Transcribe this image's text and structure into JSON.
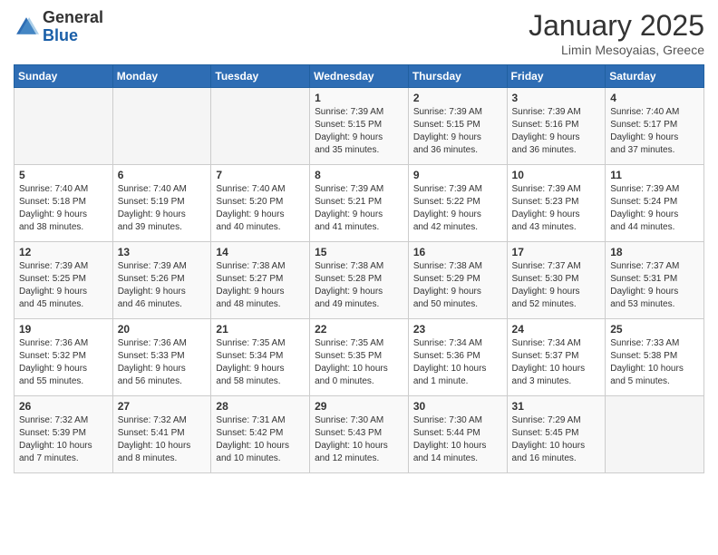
{
  "header": {
    "logo_general": "General",
    "logo_blue": "Blue",
    "month_title": "January 2025",
    "location": "Limin Mesoyaias, Greece"
  },
  "weekdays": [
    "Sunday",
    "Monday",
    "Tuesday",
    "Wednesday",
    "Thursday",
    "Friday",
    "Saturday"
  ],
  "weeks": [
    [
      {
        "day": "",
        "info": ""
      },
      {
        "day": "",
        "info": ""
      },
      {
        "day": "",
        "info": ""
      },
      {
        "day": "1",
        "info": "Sunrise: 7:39 AM\nSunset: 5:15 PM\nDaylight: 9 hours\nand 35 minutes."
      },
      {
        "day": "2",
        "info": "Sunrise: 7:39 AM\nSunset: 5:15 PM\nDaylight: 9 hours\nand 36 minutes."
      },
      {
        "day": "3",
        "info": "Sunrise: 7:39 AM\nSunset: 5:16 PM\nDaylight: 9 hours\nand 36 minutes."
      },
      {
        "day": "4",
        "info": "Sunrise: 7:40 AM\nSunset: 5:17 PM\nDaylight: 9 hours\nand 37 minutes."
      }
    ],
    [
      {
        "day": "5",
        "info": "Sunrise: 7:40 AM\nSunset: 5:18 PM\nDaylight: 9 hours\nand 38 minutes."
      },
      {
        "day": "6",
        "info": "Sunrise: 7:40 AM\nSunset: 5:19 PM\nDaylight: 9 hours\nand 39 minutes."
      },
      {
        "day": "7",
        "info": "Sunrise: 7:40 AM\nSunset: 5:20 PM\nDaylight: 9 hours\nand 40 minutes."
      },
      {
        "day": "8",
        "info": "Sunrise: 7:39 AM\nSunset: 5:21 PM\nDaylight: 9 hours\nand 41 minutes."
      },
      {
        "day": "9",
        "info": "Sunrise: 7:39 AM\nSunset: 5:22 PM\nDaylight: 9 hours\nand 42 minutes."
      },
      {
        "day": "10",
        "info": "Sunrise: 7:39 AM\nSunset: 5:23 PM\nDaylight: 9 hours\nand 43 minutes."
      },
      {
        "day": "11",
        "info": "Sunrise: 7:39 AM\nSunset: 5:24 PM\nDaylight: 9 hours\nand 44 minutes."
      }
    ],
    [
      {
        "day": "12",
        "info": "Sunrise: 7:39 AM\nSunset: 5:25 PM\nDaylight: 9 hours\nand 45 minutes."
      },
      {
        "day": "13",
        "info": "Sunrise: 7:39 AM\nSunset: 5:26 PM\nDaylight: 9 hours\nand 46 minutes."
      },
      {
        "day": "14",
        "info": "Sunrise: 7:38 AM\nSunset: 5:27 PM\nDaylight: 9 hours\nand 48 minutes."
      },
      {
        "day": "15",
        "info": "Sunrise: 7:38 AM\nSunset: 5:28 PM\nDaylight: 9 hours\nand 49 minutes."
      },
      {
        "day": "16",
        "info": "Sunrise: 7:38 AM\nSunset: 5:29 PM\nDaylight: 9 hours\nand 50 minutes."
      },
      {
        "day": "17",
        "info": "Sunrise: 7:37 AM\nSunset: 5:30 PM\nDaylight: 9 hours\nand 52 minutes."
      },
      {
        "day": "18",
        "info": "Sunrise: 7:37 AM\nSunset: 5:31 PM\nDaylight: 9 hours\nand 53 minutes."
      }
    ],
    [
      {
        "day": "19",
        "info": "Sunrise: 7:36 AM\nSunset: 5:32 PM\nDaylight: 9 hours\nand 55 minutes."
      },
      {
        "day": "20",
        "info": "Sunrise: 7:36 AM\nSunset: 5:33 PM\nDaylight: 9 hours\nand 56 minutes."
      },
      {
        "day": "21",
        "info": "Sunrise: 7:35 AM\nSunset: 5:34 PM\nDaylight: 9 hours\nand 58 minutes."
      },
      {
        "day": "22",
        "info": "Sunrise: 7:35 AM\nSunset: 5:35 PM\nDaylight: 10 hours\nand 0 minutes."
      },
      {
        "day": "23",
        "info": "Sunrise: 7:34 AM\nSunset: 5:36 PM\nDaylight: 10 hours\nand 1 minute."
      },
      {
        "day": "24",
        "info": "Sunrise: 7:34 AM\nSunset: 5:37 PM\nDaylight: 10 hours\nand 3 minutes."
      },
      {
        "day": "25",
        "info": "Sunrise: 7:33 AM\nSunset: 5:38 PM\nDaylight: 10 hours\nand 5 minutes."
      }
    ],
    [
      {
        "day": "26",
        "info": "Sunrise: 7:32 AM\nSunset: 5:39 PM\nDaylight: 10 hours\nand 7 minutes."
      },
      {
        "day": "27",
        "info": "Sunrise: 7:32 AM\nSunset: 5:41 PM\nDaylight: 10 hours\nand 8 minutes."
      },
      {
        "day": "28",
        "info": "Sunrise: 7:31 AM\nSunset: 5:42 PM\nDaylight: 10 hours\nand 10 minutes."
      },
      {
        "day": "29",
        "info": "Sunrise: 7:30 AM\nSunset: 5:43 PM\nDaylight: 10 hours\nand 12 minutes."
      },
      {
        "day": "30",
        "info": "Sunrise: 7:30 AM\nSunset: 5:44 PM\nDaylight: 10 hours\nand 14 minutes."
      },
      {
        "day": "31",
        "info": "Sunrise: 7:29 AM\nSunset: 5:45 PM\nDaylight: 10 hours\nand 16 minutes."
      },
      {
        "day": "",
        "info": ""
      }
    ]
  ]
}
